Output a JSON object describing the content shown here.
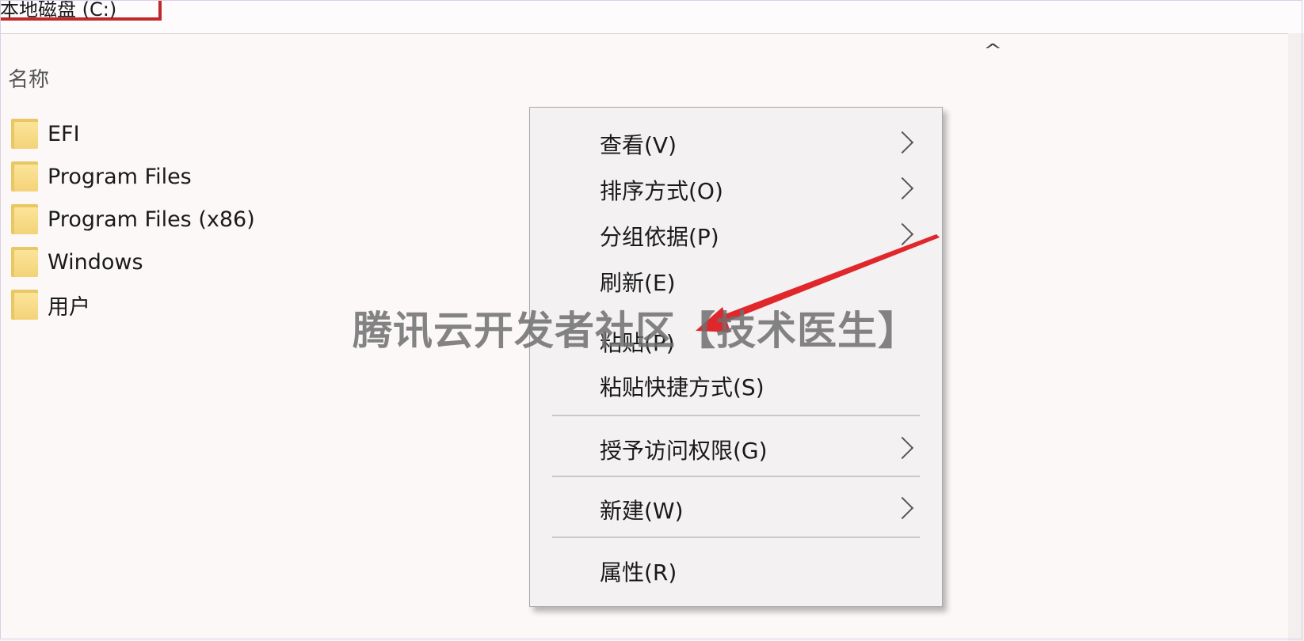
{
  "address_bar": {
    "path": "本地磁盘 (C:)"
  },
  "columns": {
    "name_header": "名称",
    "sort_icon": "chevron-up-icon"
  },
  "files": [
    {
      "name": "EFI",
      "icon": "folder-icon"
    },
    {
      "name": "Program Files",
      "icon": "folder-icon"
    },
    {
      "name": "Program Files (x86)",
      "icon": "folder-icon"
    },
    {
      "name": "Windows",
      "icon": "folder-icon"
    },
    {
      "name": "用户",
      "icon": "folder-icon"
    }
  ],
  "context_menu": {
    "items": [
      {
        "label": "查看(V)",
        "submenu": true
      },
      {
        "label": "排序方式(O)",
        "submenu": true
      },
      {
        "label": "分组依据(P)",
        "submenu": true
      },
      {
        "label": "刷新(E)",
        "submenu": false
      },
      {
        "label": "粘贴(P)",
        "submenu": false
      },
      {
        "label": "粘贴快捷方式(S)",
        "submenu": false
      },
      {
        "label": "授予访问权限(G)",
        "submenu": true
      },
      {
        "label": "新建(W)",
        "submenu": true
      },
      {
        "label": "属性(R)",
        "submenu": false
      }
    ]
  },
  "annotation": {
    "color": "#e0272b",
    "target": "粘贴(P)"
  },
  "watermark": {
    "text": "腾讯云开发者社区【技术医生】"
  },
  "colors": {
    "highlight_box": "#c0282a",
    "folder": "#f4d378"
  }
}
